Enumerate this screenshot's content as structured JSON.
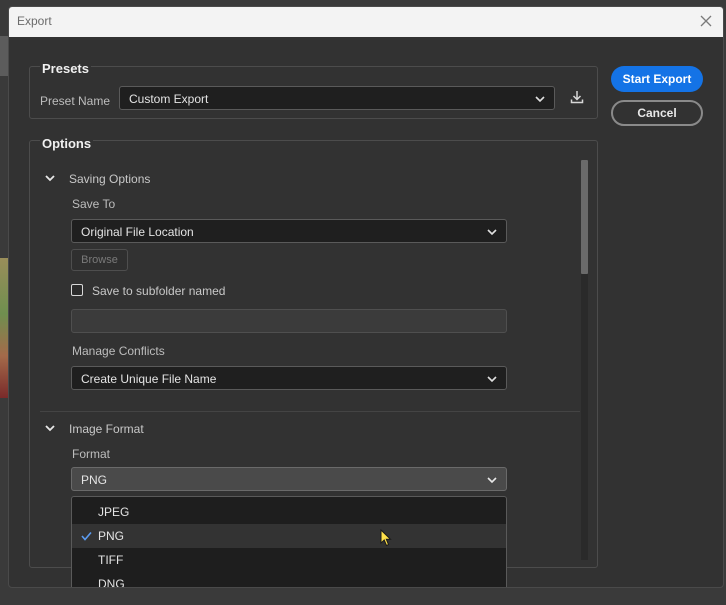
{
  "window": {
    "title": "Export"
  },
  "presets": {
    "heading": "Presets",
    "name_label": "Preset Name",
    "name_value": "Custom Export"
  },
  "actions": {
    "start_label": "Start Export",
    "cancel_label": "Cancel"
  },
  "options": {
    "heading": "Options",
    "saving": {
      "title": "Saving Options",
      "save_to_label": "Save To",
      "save_to_value": "Original File Location",
      "browse_label": "Browse",
      "subfolder_label": "Save to subfolder named",
      "subfolder_checked": false,
      "subfolder_value": "",
      "conflicts_label": "Manage Conflicts",
      "conflicts_value": "Create Unique File Name"
    },
    "image_format": {
      "title": "Image Format",
      "format_label": "Format",
      "format_value": "PNG",
      "format_options": [
        "JPEG",
        "PNG",
        "TIFF",
        "DNG"
      ],
      "selected_index": 1
    }
  },
  "icons": {
    "close": "close-icon",
    "save_preset": "download-icon",
    "chevron": "chevron-down-icon",
    "check": "checkmark-icon",
    "cursor": "mouse-pointer-icon"
  },
  "colors": {
    "accent": "#1473e6",
    "cursor": "#ffe14a"
  }
}
